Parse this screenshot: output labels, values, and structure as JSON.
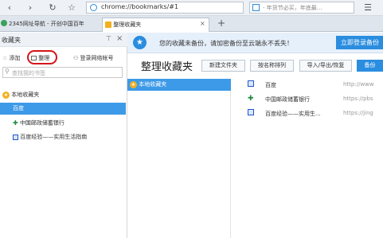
{
  "nav": {
    "address": "chrome://bookmarks/#1",
    "search_placeholder": "- 年货节必买，年底最..."
  },
  "tabs": [
    {
      "label": "2345网址导航 - 开创中国百年"
    },
    {
      "label": "整理收藏夹"
    }
  ],
  "sidebar": {
    "title": "收藏夹",
    "pin": "⊤",
    "close": "×",
    "add_label": "添加",
    "organize_label": "整理",
    "login_label": "登录网络帐号",
    "search_placeholder": "查找我的书签",
    "folder_label": "本地收藏夹",
    "items": [
      {
        "label": "百度"
      },
      {
        "label": "中国邮政储蓄银行"
      },
      {
        "label": "百度经验——实用生活指南"
      }
    ]
  },
  "banner": {
    "text": "您的收藏未备份，请加密备份至云端永不丢失！",
    "login_button": "立即登录备份"
  },
  "main": {
    "title": "整理收藏夹",
    "buttons": {
      "new_folder": "新建文件夹",
      "sort_by_name": "按名称排列",
      "import_export": "导入/导出/恢复",
      "backup": "备份"
    },
    "folder_label": "本地收藏夹",
    "bookmarks": [
      {
        "name": "百度",
        "url": "http://www"
      },
      {
        "name": "中国邮政储蓄银行",
        "url": "https://pbs"
      },
      {
        "name": "百度经验——实用生...",
        "url": "https://jing"
      }
    ]
  },
  "colors": {
    "accent": "#2a8ddf",
    "selection": "#3d9ae8",
    "annotation": "#d4141a"
  }
}
